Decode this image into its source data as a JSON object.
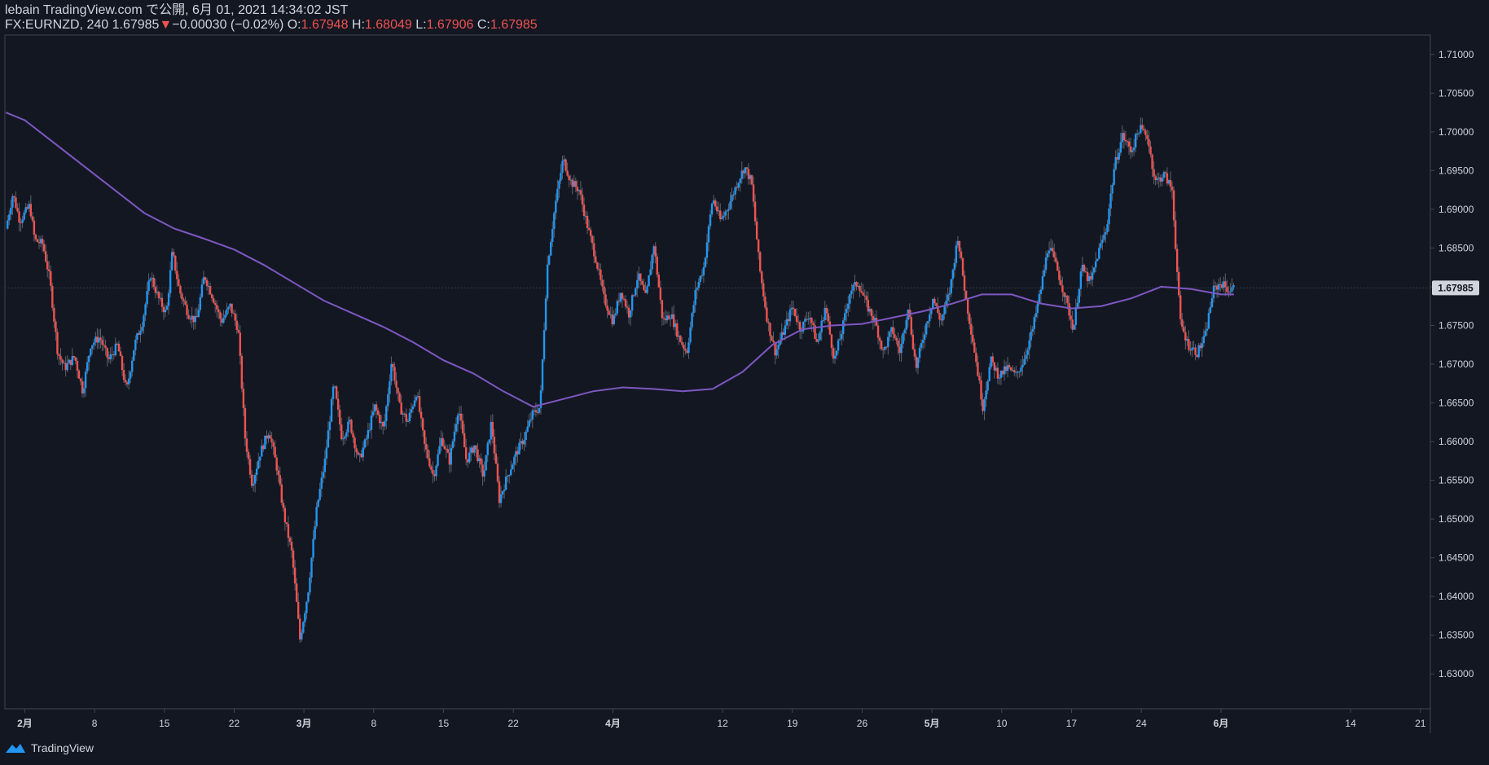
{
  "header": {
    "line1": "lebain TradingView.com で公開, 6月 01, 2021 14:34:02 JST",
    "symbol_prefix": "FX:EURNZD, 240 ",
    "last": "1.67985",
    "change": "−0.00030 (−0.02%)",
    "o_label": "O:",
    "o_value": "1.67948",
    "h_label": "H:",
    "h_value": "1.68049",
    "l_label": "L:",
    "l_value": "1.67906",
    "c_label": "C:",
    "c_value": "1.67985"
  },
  "footer": {
    "brand": "TradingView"
  },
  "colors": {
    "background": "#131722",
    "up": "#2196f3",
    "down": "#ef5350",
    "ma": "#7e57c2",
    "axis_text": "#d1d4dc",
    "grid_border": "#434651",
    "price_label_bg": "#d1d4dc",
    "price_label_text": "#131722"
  },
  "chart_data": {
    "type": "candlestick",
    "title": "",
    "symbol": "FX:EURNZD",
    "interval": "240",
    "ylim": [
      1.6255,
      1.7125
    ],
    "y_ticks": [
      "1.71000",
      "1.70500",
      "1.70000",
      "1.69500",
      "1.69000",
      "1.68500",
      "1.68000",
      "1.67500",
      "1.67000",
      "1.66500",
      "1.66000",
      "1.65500",
      "1.65000",
      "1.64500",
      "1.64000",
      "1.63500",
      "1.63000"
    ],
    "last_price_label": "1.67985",
    "last_price": 1.67985,
    "x_ticks": [
      {
        "label": "2月",
        "day": 0,
        "bold": true
      },
      {
        "label": "8",
        "day": 7
      },
      {
        "label": "15",
        "day": 14
      },
      {
        "label": "22",
        "day": 21
      },
      {
        "label": "3月",
        "day": 28,
        "bold": true
      },
      {
        "label": "8",
        "day": 35
      },
      {
        "label": "15",
        "day": 42
      },
      {
        "label": "22",
        "day": 49
      },
      {
        "label": "4月",
        "day": 59,
        "bold": true
      },
      {
        "label": "12",
        "day": 70
      },
      {
        "label": "19",
        "day": 77
      },
      {
        "label": "26",
        "day": 84
      },
      {
        "label": "5月",
        "day": 91,
        "bold": true
      },
      {
        "label": "10",
        "day": 98
      },
      {
        "label": "17",
        "day": 105
      },
      {
        "label": "24",
        "day": 112
      },
      {
        "label": "6月",
        "day": 120,
        "bold": true
      },
      {
        "label": "14",
        "day": 133
      },
      {
        "label": "21",
        "day": 140
      }
    ],
    "x_range_days": [
      -2,
      141
    ],
    "price_path": [
      [
        -1.9,
        1.6875
      ],
      [
        -1.2,
        1.692
      ],
      [
        -0.5,
        1.6885
      ],
      [
        0.5,
        1.6905
      ],
      [
        1.0,
        1.686
      ],
      [
        1.8,
        1.6855
      ],
      [
        2.5,
        1.681
      ],
      [
        3.3,
        1.6715
      ],
      [
        4.0,
        1.6695
      ],
      [
        5.0,
        1.671
      ],
      [
        5.8,
        1.6665
      ],
      [
        6.6,
        1.6725
      ],
      [
        7.5,
        1.6735
      ],
      [
        8.4,
        1.6705
      ],
      [
        9.3,
        1.6725
      ],
      [
        10.2,
        1.6665
      ],
      [
        11.0,
        1.6725
      ],
      [
        11.8,
        1.6755
      ],
      [
        12.6,
        1.6815
      ],
      [
        13.4,
        1.6785
      ],
      [
        14.2,
        1.6765
      ],
      [
        14.8,
        1.6845
      ],
      [
        15.5,
        1.6795
      ],
      [
        16.4,
        1.6765
      ],
      [
        17.2,
        1.6755
      ],
      [
        18.0,
        1.6815
      ],
      [
        18.9,
        1.6785
      ],
      [
        19.7,
        1.6755
      ],
      [
        20.6,
        1.6775
      ],
      [
        21.4,
        1.6745
      ],
      [
        22.1,
        1.6605
      ],
      [
        22.8,
        1.6545
      ],
      [
        23.6,
        1.6585
      ],
      [
        24.5,
        1.6615
      ],
      [
        25.3,
        1.6565
      ],
      [
        26.0,
        1.6505
      ],
      [
        26.8,
        1.6455
      ],
      [
        27.6,
        1.6345
      ],
      [
        28.4,
        1.6405
      ],
      [
        29.3,
        1.6515
      ],
      [
        30.1,
        1.6575
      ],
      [
        31.0,
        1.6675
      ],
      [
        31.8,
        1.6605
      ],
      [
        32.6,
        1.6625
      ],
      [
        33.5,
        1.6575
      ],
      [
        34.3,
        1.6605
      ],
      [
        35.1,
        1.6645
      ],
      [
        36.0,
        1.6615
      ],
      [
        36.8,
        1.6705
      ],
      [
        37.6,
        1.6645
      ],
      [
        38.4,
        1.6625
      ],
      [
        39.3,
        1.6665
      ],
      [
        40.1,
        1.6595
      ],
      [
        41.0,
        1.6555
      ],
      [
        41.8,
        1.6605
      ],
      [
        42.6,
        1.6575
      ],
      [
        43.5,
        1.6645
      ],
      [
        44.3,
        1.6575
      ],
      [
        45.1,
        1.6595
      ],
      [
        46.0,
        1.6555
      ],
      [
        46.8,
        1.6625
      ],
      [
        47.6,
        1.6525
      ],
      [
        48.4,
        1.6555
      ],
      [
        49.3,
        1.6585
      ],
      [
        50.1,
        1.6605
      ],
      [
        50.9,
        1.6635
      ],
      [
        51.7,
        1.6645
      ],
      [
        52.4,
        1.6825
      ],
      [
        53.2,
        1.6905
      ],
      [
        54.0,
        1.6965
      ],
      [
        54.8,
        1.6935
      ],
      [
        55.6,
        1.6925
      ],
      [
        56.5,
        1.6875
      ],
      [
        57.3,
        1.6835
      ],
      [
        58.1,
        1.6785
      ],
      [
        59.0,
        1.6755
      ],
      [
        59.8,
        1.6795
      ],
      [
        60.6,
        1.6765
      ],
      [
        61.5,
        1.6815
      ],
      [
        62.3,
        1.6785
      ],
      [
        63.1,
        1.6855
      ],
      [
        64.0,
        1.6755
      ],
      [
        64.8,
        1.6765
      ],
      [
        65.6,
        1.6735
      ],
      [
        66.4,
        1.6715
      ],
      [
        67.3,
        1.6795
      ],
      [
        68.1,
        1.6825
      ],
      [
        69.0,
        1.6915
      ],
      [
        69.8,
        1.6885
      ],
      [
        70.6,
        1.6905
      ],
      [
        71.5,
        1.6935
      ],
      [
        72.2,
        1.6955
      ],
      [
        72.9,
        1.6935
      ],
      [
        73.7,
        1.6825
      ],
      [
        74.5,
        1.6755
      ],
      [
        75.3,
        1.6715
      ],
      [
        76.2,
        1.6745
      ],
      [
        77.0,
        1.6775
      ],
      [
        77.8,
        1.6745
      ],
      [
        78.7,
        1.6765
      ],
      [
        79.5,
        1.6725
      ],
      [
        80.3,
        1.6775
      ],
      [
        81.2,
        1.6705
      ],
      [
        82.0,
        1.6745
      ],
      [
        82.8,
        1.6795
      ],
      [
        83.6,
        1.6805
      ],
      [
        84.5,
        1.6775
      ],
      [
        85.3,
        1.6755
      ],
      [
        86.1,
        1.6715
      ],
      [
        87.0,
        1.6745
      ],
      [
        87.8,
        1.6715
      ],
      [
        88.6,
        1.6775
      ],
      [
        89.4,
        1.6695
      ],
      [
        90.3,
        1.6745
      ],
      [
        91.1,
        1.6785
      ],
      [
        91.9,
        1.6755
      ],
      [
        92.8,
        1.6795
      ],
      [
        93.6,
        1.6865
      ],
      [
        94.4,
        1.6785
      ],
      [
        95.3,
        1.6715
      ],
      [
        96.1,
        1.6645
      ],
      [
        96.9,
        1.6705
      ],
      [
        97.7,
        1.6685
      ],
      [
        98.6,
        1.6695
      ],
      [
        99.4,
        1.6685
      ],
      [
        100.2,
        1.6705
      ],
      [
        101.1,
        1.6745
      ],
      [
        101.9,
        1.6795
      ],
      [
        102.7,
        1.6855
      ],
      [
        103.5,
        1.6825
      ],
      [
        104.4,
        1.6785
      ],
      [
        105.2,
        1.6745
      ],
      [
        106.0,
        1.6825
      ],
      [
        106.9,
        1.6805
      ],
      [
        107.7,
        1.6845
      ],
      [
        108.5,
        1.6875
      ],
      [
        109.3,
        1.6955
      ],
      [
        110.1,
        1.6995
      ],
      [
        111.0,
        1.6975
      ],
      [
        111.8,
        1.7005
      ],
      [
        112.6,
        1.6995
      ],
      [
        113.4,
        1.6935
      ],
      [
        114.3,
        1.6945
      ],
      [
        115.1,
        1.6925
      ],
      [
        115.9,
        1.6755
      ],
      [
        116.7,
        1.6725
      ],
      [
        117.6,
        1.6715
      ],
      [
        118.4,
        1.6735
      ],
      [
        119.2,
        1.6795
      ],
      [
        120.0,
        1.6805
      ],
      [
        120.8,
        1.6795
      ],
      [
        121.3,
        1.6798
      ]
    ],
    "ma_path": [
      [
        -1.9,
        1.7025
      ],
      [
        0,
        1.7015
      ],
      [
        3,
        1.6985
      ],
      [
        6,
        1.6955
      ],
      [
        9,
        1.6925
      ],
      [
        12,
        1.6895
      ],
      [
        15,
        1.6875
      ],
      [
        18,
        1.6862
      ],
      [
        21,
        1.6848
      ],
      [
        24,
        1.6828
      ],
      [
        27,
        1.6805
      ],
      [
        30,
        1.6782
      ],
      [
        33,
        1.6765
      ],
      [
        36,
        1.6748
      ],
      [
        39,
        1.6728
      ],
      [
        42,
        1.6705
      ],
      [
        45,
        1.6688
      ],
      [
        48,
        1.6665
      ],
      [
        51,
        1.6645
      ],
      [
        54,
        1.6655
      ],
      [
        57,
        1.6665
      ],
      [
        60,
        1.667
      ],
      [
        63,
        1.6668
      ],
      [
        66,
        1.6665
      ],
      [
        69,
        1.6668
      ],
      [
        72,
        1.669
      ],
      [
        75,
        1.6725
      ],
      [
        78,
        1.6745
      ],
      [
        81,
        1.675
      ],
      [
        84,
        1.6752
      ],
      [
        87,
        1.676
      ],
      [
        90,
        1.6768
      ],
      [
        93,
        1.6778
      ],
      [
        96,
        1.679
      ],
      [
        99,
        1.679
      ],
      [
        102,
        1.6778
      ],
      [
        105,
        1.6772
      ],
      [
        108,
        1.6775
      ],
      [
        111,
        1.6785
      ],
      [
        114,
        1.68
      ],
      [
        117,
        1.6797
      ],
      [
        120,
        1.679
      ],
      [
        121.3,
        1.679
      ]
    ]
  }
}
